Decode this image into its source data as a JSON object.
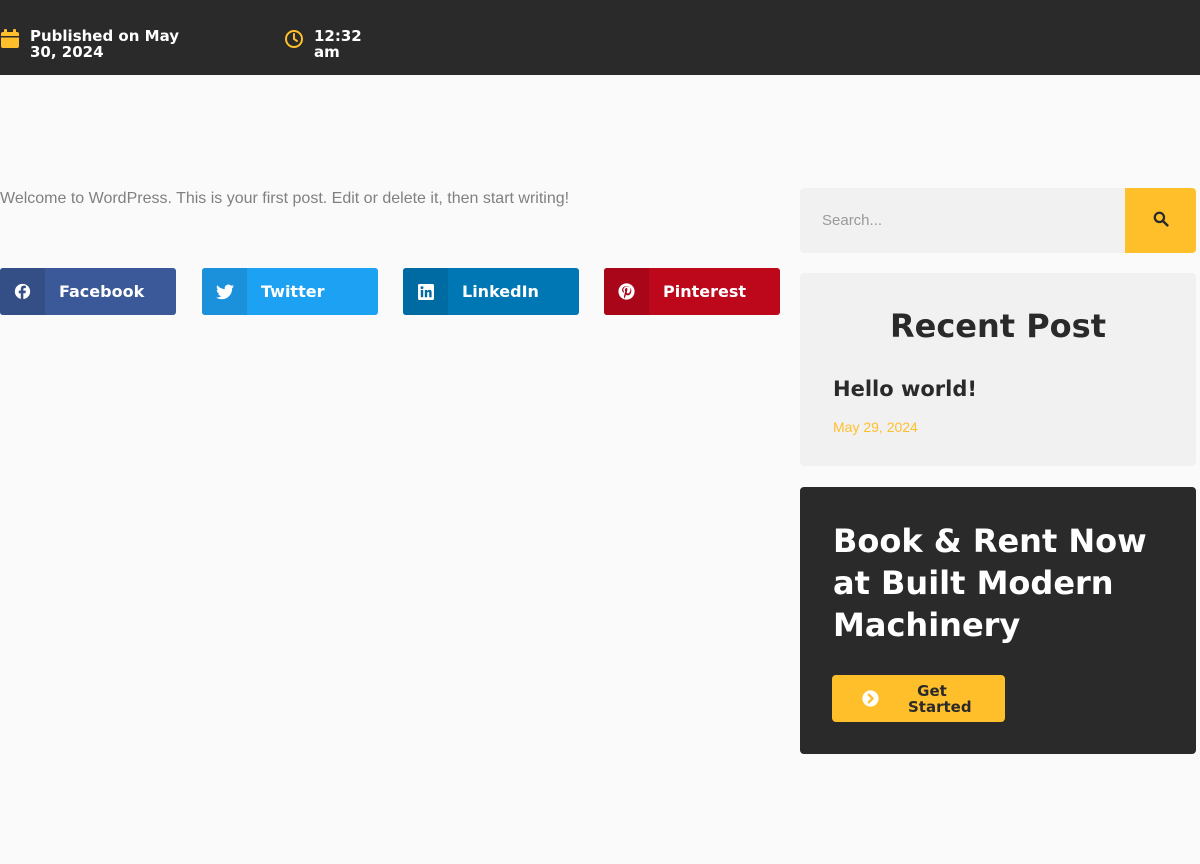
{
  "meta": {
    "published": "Published on May 30, 2024",
    "time": "12:32 am"
  },
  "post": {
    "content": "Welcome to WordPress. This is your first post. Edit or delete it, then start writing!"
  },
  "share": {
    "facebook": "Facebook",
    "twitter": "Twitter",
    "linkedin": "LinkedIn",
    "pinterest": "Pinterest"
  },
  "sidebar": {
    "search": {
      "placeholder": "Search..."
    },
    "recent": {
      "heading": "Recent Post",
      "items": [
        {
          "title": "Hello world!",
          "date": "May 29, 2024"
        }
      ]
    },
    "cta": {
      "title": "Book & Rent Now at Built Modern Machinery",
      "button": "Get Started"
    }
  },
  "colors": {
    "accent": "#ffbf2b",
    "dark": "#2a2a2a",
    "facebook": "#3b5998",
    "twitter": "#1da1f2",
    "linkedin": "#0077b5",
    "pinterest": "#bd081c"
  }
}
